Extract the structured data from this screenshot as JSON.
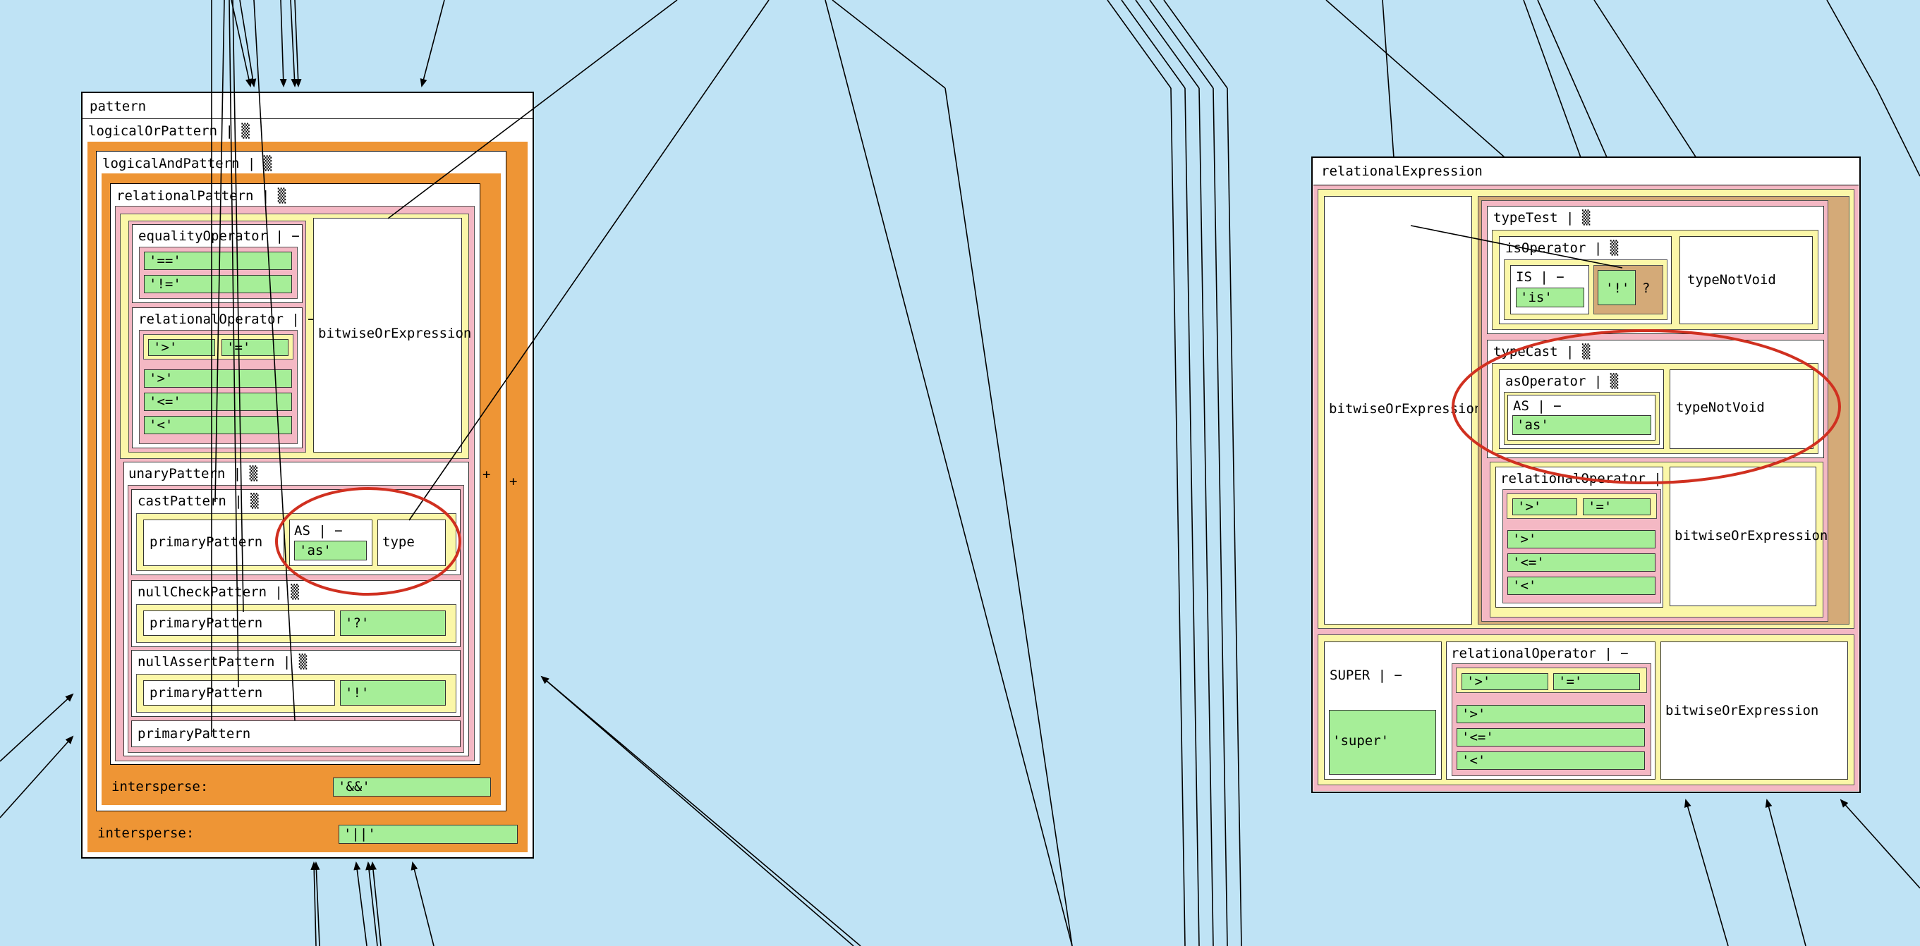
{
  "pattern": {
    "title": "pattern",
    "logicalOr": "logicalOrPattern | ▒",
    "logicalAnd": "logicalAndPattern | ▒",
    "relational": "relationalPattern | ▒",
    "equalityOperator": "equalityOperator | −",
    "eq": "'=='",
    "neq": "'!='",
    "relationalOperator": "relationalOperator | −",
    "gt": "'>'",
    "eqSign": "'='",
    "gt2": "'>'",
    "le": "'<='",
    "lt": "'<'",
    "bitwiseOr": "bitwiseOrExpression",
    "unary": "unaryPattern | ▒",
    "cast": "castPattern | ▒",
    "primary1": "primaryPattern",
    "asOp": "AS | −",
    "asLit": "'as'",
    "type": "type",
    "nullCheck": "nullCheckPattern | ▒",
    "primary2": "primaryPattern",
    "q": "'?'",
    "nullAssert": "nullAssertPattern | ▒",
    "primary3": "primaryPattern",
    "bang": "'!'",
    "primary4": "primaryPattern",
    "plus1": "+",
    "plus2": "+",
    "intersperseAnd": "intersperse:",
    "andLit": "'&&'",
    "intersperseOr": "intersperse:",
    "orLit": "'||'"
  },
  "relExpr": {
    "title": "relationalExpression",
    "bitwiseOr": "bitwiseOrExpression",
    "typeTest": "typeTest | ▒",
    "isOperator": "isOperator | ▒",
    "is": "IS | −",
    "isLit": "'is'",
    "bang": "'!'",
    "qmark": "?",
    "typeNotVoid1": "typeNotVoid",
    "typeCast": "typeCast | ▒",
    "asOperator": "asOperator | ▒",
    "as": "AS | −",
    "asLit": "'as'",
    "typeNotVoid2": "typeNotVoid",
    "relOp1": "relationalOperator | −",
    "gt": "'>'",
    "eqSign": "'='",
    "gt2": "'>'",
    "le": "'<='",
    "lt": "'<'",
    "bitwiseOr2": "bitwiseOrExpression",
    "super": "SUPER | −",
    "superLit": "'super'",
    "relOp2": "relationalOperator | −",
    "gtB": "'>'",
    "eqSignB": "'='",
    "gt2B": "'>'",
    "leB": "'<='",
    "ltB": "'<'",
    "bitwiseOr3": "bitwiseOrExpression"
  },
  "colors": {
    "background": "#bfe3f5",
    "orange": "#ee9535",
    "pink": "#f4b8c4",
    "yellow": "#fbf7a8",
    "green": "#a6ee98",
    "tan": "#d4aa78",
    "highlight": "#d03020"
  }
}
